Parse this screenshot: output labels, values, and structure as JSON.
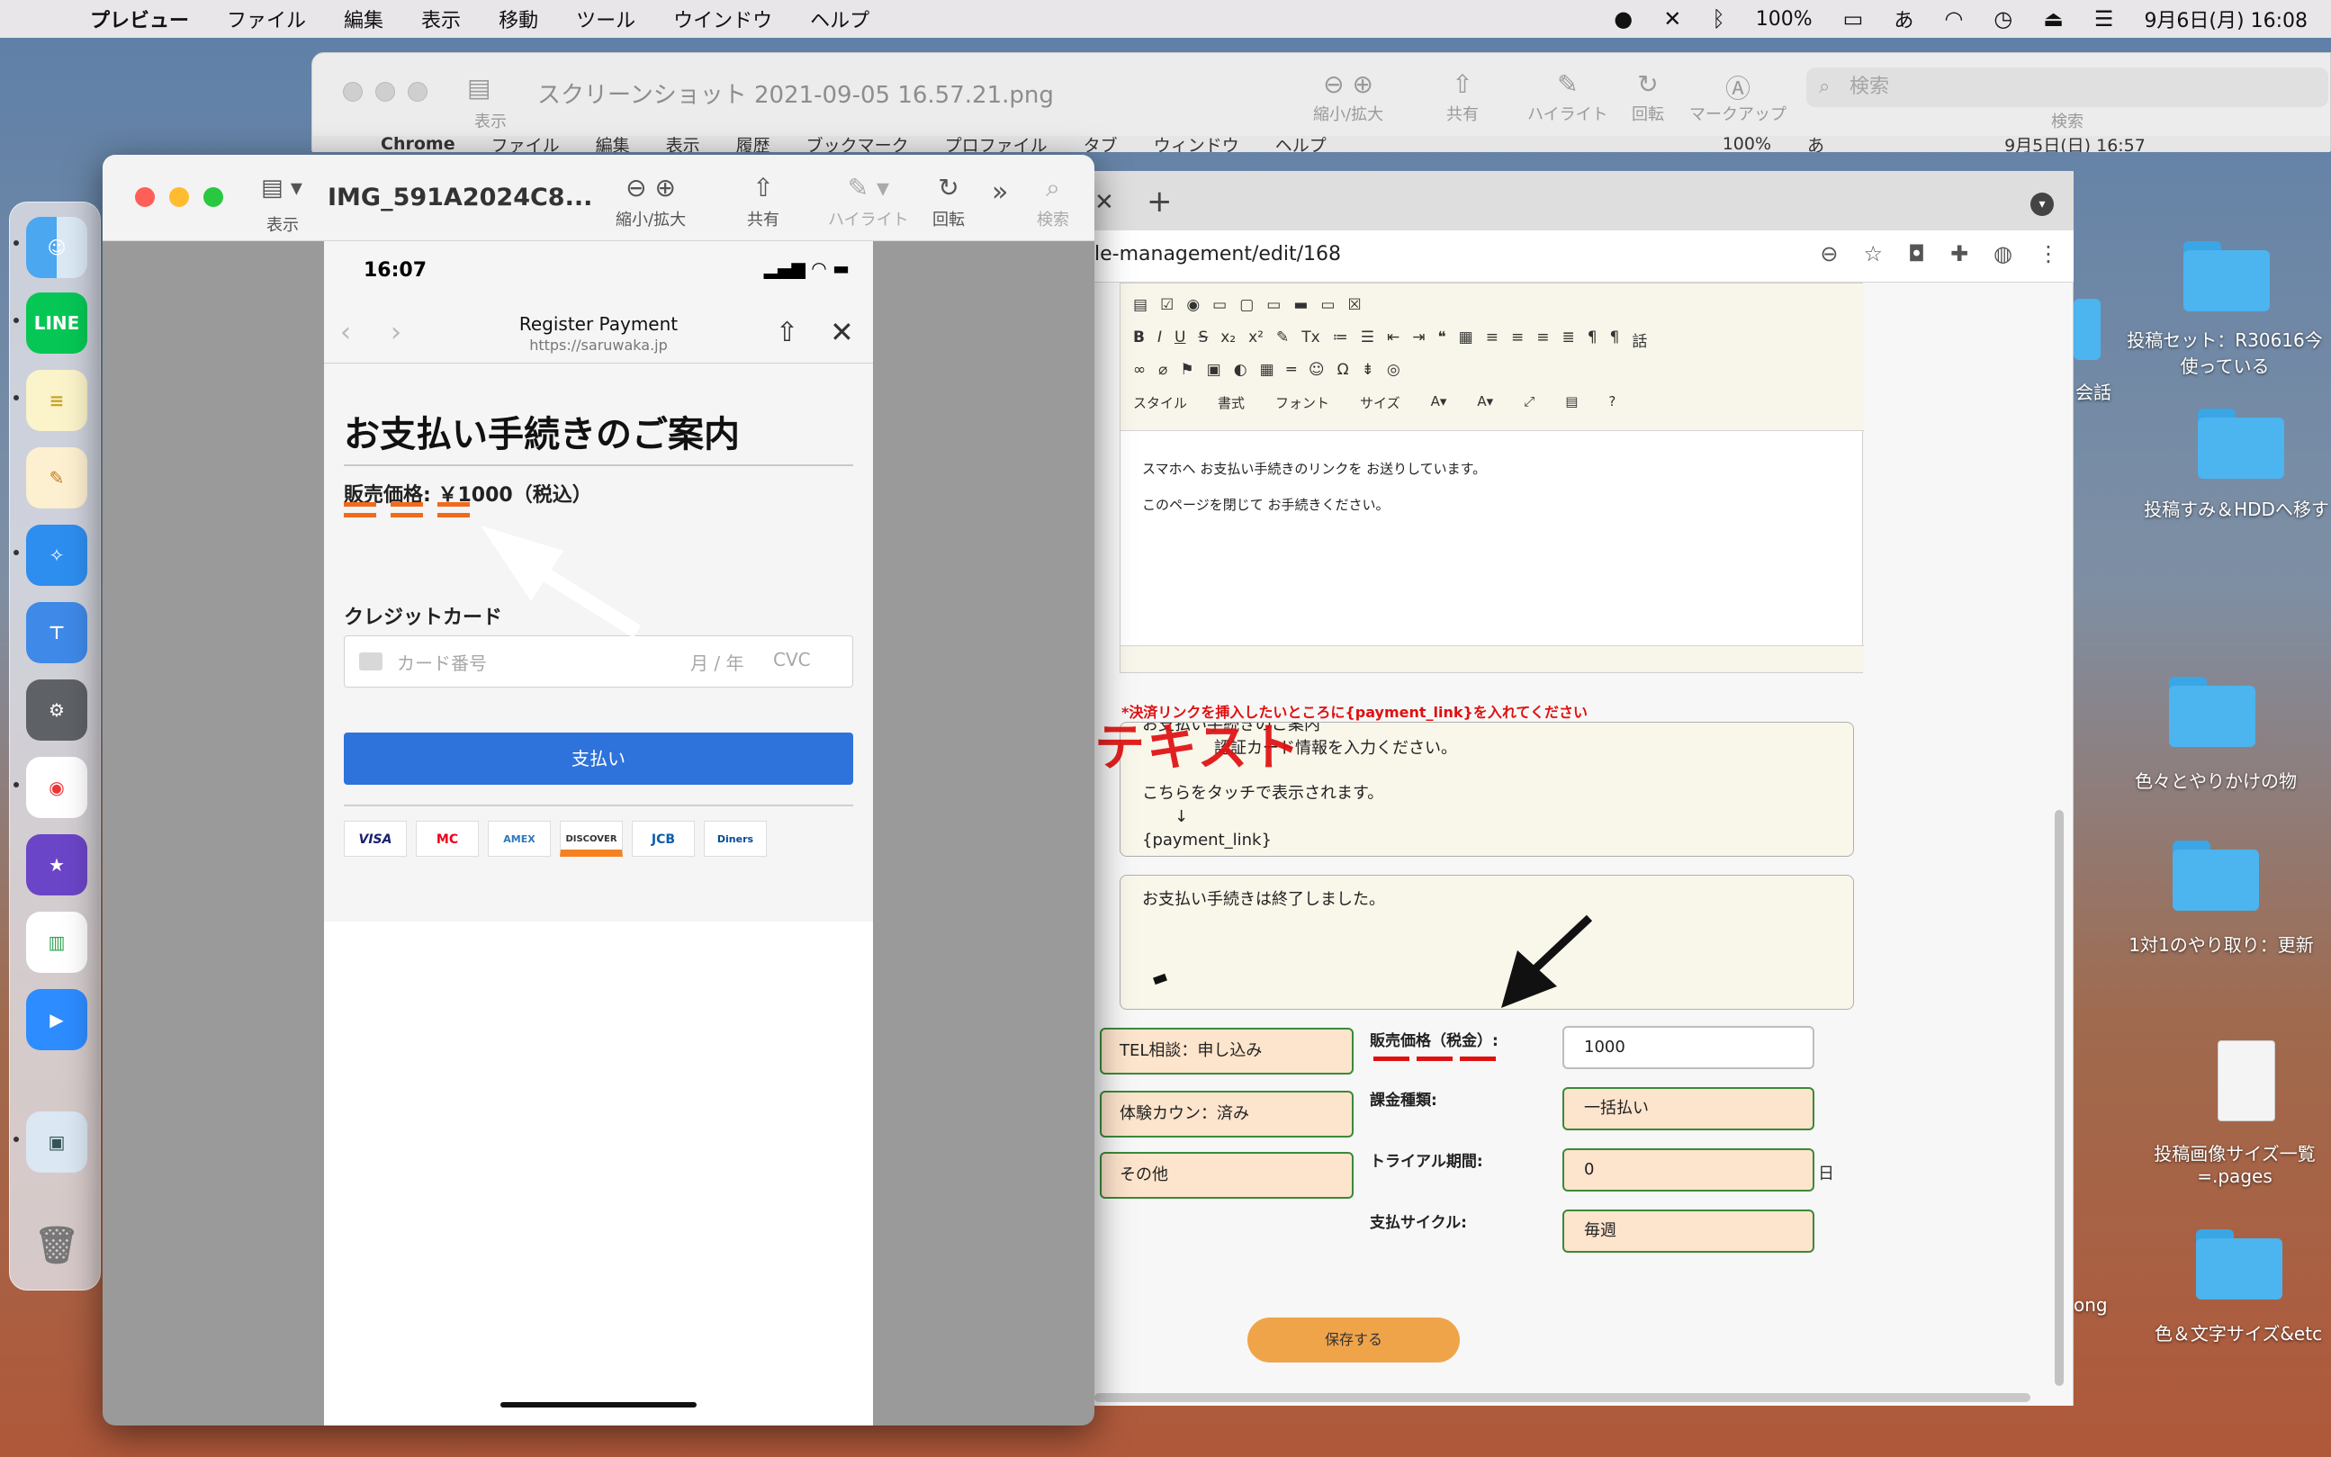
{
  "menubar": {
    "app": "プレビュー",
    "items": [
      "ファイル",
      "編集",
      "表示",
      "移動",
      "ツール",
      "ウインドウ",
      "ヘルプ"
    ],
    "battery": "100%",
    "ime": "あ",
    "datetime": "9月6日(月) 16:08"
  },
  "back_window": {
    "title": "スクリーンショット 2021-09-05 16.57.21.png",
    "view_label": "表示",
    "tools": [
      "縮小/拡大",
      "共有",
      "ハイライト",
      "回転",
      "マークアップ"
    ],
    "search_placeholder": "検索",
    "search_label": "検索",
    "inner_menubar": {
      "app": "Chrome",
      "items": [
        "ファイル",
        "編集",
        "表示",
        "履歴",
        "ブックマーク",
        "プロファイル",
        "タブ",
        "ウィンドウ",
        "ヘルプ"
      ],
      "battery": "100%",
      "ime": "あ",
      "datetime": "9月5日(日) 16:57"
    }
  },
  "desktop": {
    "items": [
      "投稿セット：R30616今\n使っている",
      "会話",
      "投稿すみ＆HDDへ移す",
      "色々とやりかけの物",
      "1対1のやり取り：更新",
      "投稿画像サイズ一覧\n=.pages",
      "ong",
      "色＆文字サイズ&etc"
    ]
  },
  "preview": {
    "title": "IMG_591A2024C8...",
    "view_label": "表示",
    "tools": [
      "縮小/拡大",
      "共有",
      "ハイライト",
      "回転",
      "検索"
    ]
  },
  "phone": {
    "time": "16:07",
    "nav_title": "Register Payment",
    "nav_url": "https://saruwaka.jp",
    "heading": "お支払い手続きのご案内",
    "price": "販売価格: ￥1000（税込）",
    "cc_label": "クレジットカード",
    "cc_number_placeholder": "カード番号",
    "cc_expiry_placeholder": "月 / 年",
    "cc_cvc_placeholder": "CVC",
    "pay_button": "支払い",
    "card_brands": [
      "VISA",
      "MC",
      "AMEX",
      "DISCOVER",
      "JCB",
      "Diners"
    ]
  },
  "chrome": {
    "url": "le-management/edit/168",
    "editor": {
      "toolbar_row3": [
        "スタイル",
        "書式",
        "フォント",
        "サイズ"
      ],
      "body_lines": [
        "スマホへ お支払い手続きのリンクを お送りしています。",
        "このページを閉じて お手続きください。"
      ]
    },
    "warning": "*決済リンクを挿入したいところに{payment_link}を入れてください",
    "textarea1_lines": [
      "お支払い手続きのご案内",
      "認証カード情報を入力ください。",
      "",
      "こちらをタッチで表示されます。",
      "↓",
      "{payment_link}"
    ],
    "textarea2": "お支払い手続きは終了しました。",
    "overlay_text": "テキスト",
    "left_buttons": [
      "TEL相談：申し込み",
      "体験カウン：済み",
      "その他"
    ],
    "fields": [
      {
        "label": "販売価格（税金）:",
        "value": "1000"
      },
      {
        "label": "課金種類:",
        "value": "一括払い"
      },
      {
        "label": "トライアル期間:",
        "value": "0",
        "unit": "日"
      },
      {
        "label": "支払サイクル:",
        "value": "毎週"
      }
    ],
    "save_button": "保存する"
  },
  "colors": {
    "accent_blue": "#2e72db",
    "annotation_red": "#e01010",
    "annotation_orange": "#f06a1e",
    "save_orange": "#f0a44a"
  }
}
